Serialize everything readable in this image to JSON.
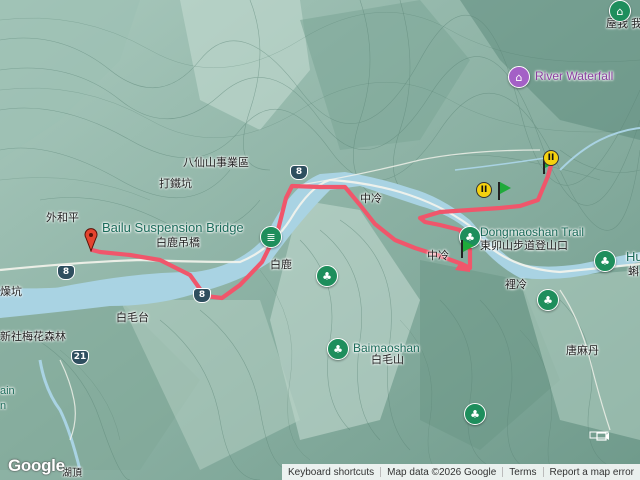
{
  "map": {
    "labels": {
      "bailu_bridge_en": "Bailu Suspension Bridge",
      "bailu_bridge_zh": "白鹿吊橋",
      "baxianshan": "八仙山事業區",
      "dadingkeng": "打鐵坑",
      "waihe_ping": "外和平",
      "bailu": "白鹿",
      "baimaoshan_en": "Baimaoshan",
      "baimaoshan_zh": "白毛山",
      "baimaotai": "白毛台",
      "zhongleng": "中冷",
      "lileng": "裡冷",
      "tangmadan": "唐麻丹",
      "river_waterfall": "River Waterfall",
      "dongmaoshan_en": "Dongmaoshan Trail",
      "dongmaoshan_zh": "東卯山步道登山口",
      "xinshe_plum": "新社梅花森林",
      "dongkeng": "燥坑",
      "upper_right": "屋我 我",
      "top_right": "我",
      "hu_partial": "Hu",
      "hu_zh_partial": "蝌",
      "ain_partial": "ain",
      "n_partial": "n",
      "zhongleng_top": "中冷",
      "bottom_left_partial": "湖頂"
    },
    "route_shields": [
      "8",
      "8",
      "8",
      "21"
    ],
    "markers": {
      "start": "red-pin",
      "end": "green-flag",
      "pause_labels": [
        "II",
        "II"
      ]
    },
    "colors": {
      "track": "#f0566b",
      "river": "#a9d3e3",
      "poi_green": "#1e8e5c",
      "poi_purple": "#a460c6"
    }
  },
  "attribution": {
    "logo": "Google",
    "keyboard_shortcuts": "Keyboard shortcuts",
    "map_data": "Map data ©2026 Google",
    "terms": "Terms",
    "report": "Report a map error"
  }
}
